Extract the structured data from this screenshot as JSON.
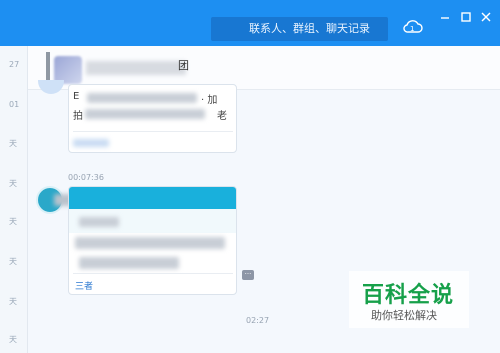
{
  "search": {
    "placeholder": "联系人、群组、聊天记录"
  },
  "left_strip": {
    "labels": [
      "27",
      "01",
      "天",
      "天",
      "天",
      "天",
      "天",
      "天"
    ]
  },
  "chat": {
    "title_suffix": "团",
    "card1": {
      "line1_start": "E",
      "line1_end": "· 加",
      "line2_start": "拍",
      "line2_end": "老"
    },
    "time_1": "00:07:36",
    "time_2": "02:27",
    "card2": {
      "link_text": "三者"
    }
  },
  "watermark": {
    "title": "百科全说",
    "subtitle": "助你轻松解决"
  }
}
